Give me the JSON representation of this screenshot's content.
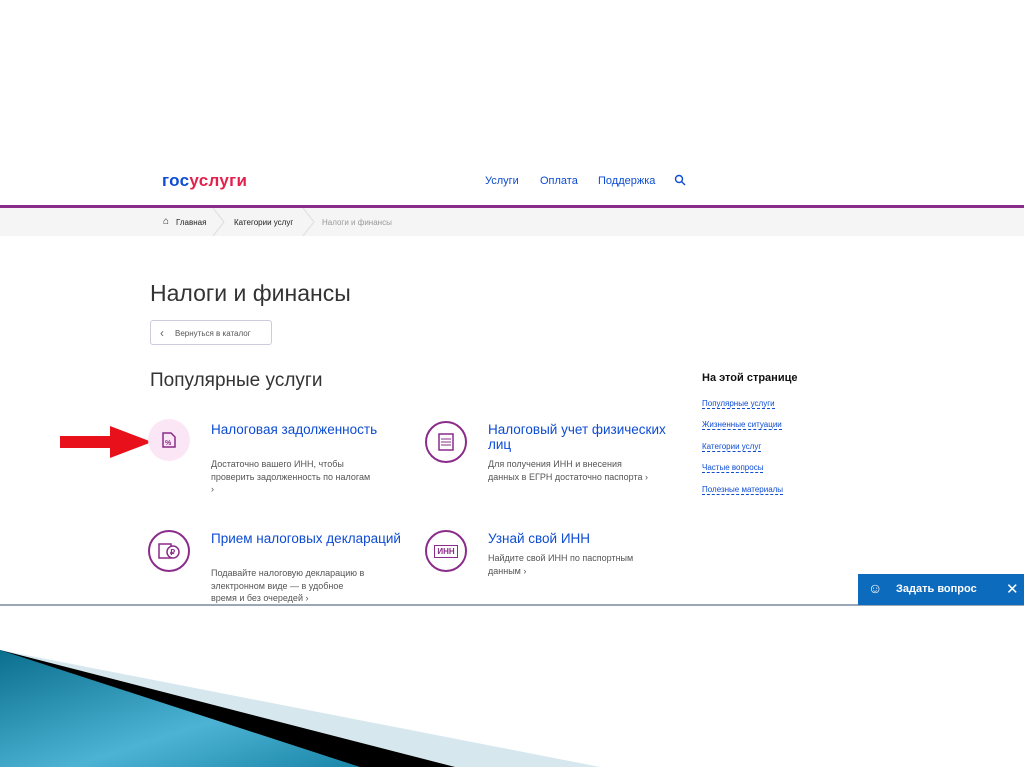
{
  "header": {
    "logo_part1": "гос",
    "logo_part2": "услуги",
    "nav": [
      "Услуги",
      "Оплата",
      "Поддержка"
    ]
  },
  "breadcrumbs": [
    "Главная",
    "Категории услуг",
    "Налоги и финансы"
  ],
  "page_title": "Налоги и финансы",
  "back_button": "Вернуться в каталог",
  "section_title": "Популярные услуги",
  "cards": [
    {
      "title": "Налоговая задолженность",
      "desc": "Достаточно вашего ИНН, чтобы проверить задолженность по налогам ›"
    },
    {
      "title": "Налоговый учет физических лиц",
      "desc": "Для получения ИНН и внесения данных в ЕГРН достаточно паспорта ›"
    },
    {
      "title": "Прием налоговых деклараций",
      "desc": "Подавайте налоговую декларацию в электронном виде — в удобное время и без очередей ›"
    },
    {
      "title": "Узнай свой ИНН",
      "desc": "Найдите свой ИНН по паспортным данным ›",
      "icon_text": "ИНН"
    }
  ],
  "sidebar": {
    "title": "На этой странице",
    "links": [
      "Популярные услуги",
      "Жизненные ситуации",
      "Категории услуг",
      "Частые вопросы",
      "Полезные материалы"
    ]
  },
  "chat": {
    "label": "Задать вопрос"
  },
  "colors": {
    "brand_blue": "#0d4cd3",
    "brand_red": "#e4214c",
    "accent_purple": "#8a2c8a",
    "chat_blue": "#0d6bbd"
  }
}
